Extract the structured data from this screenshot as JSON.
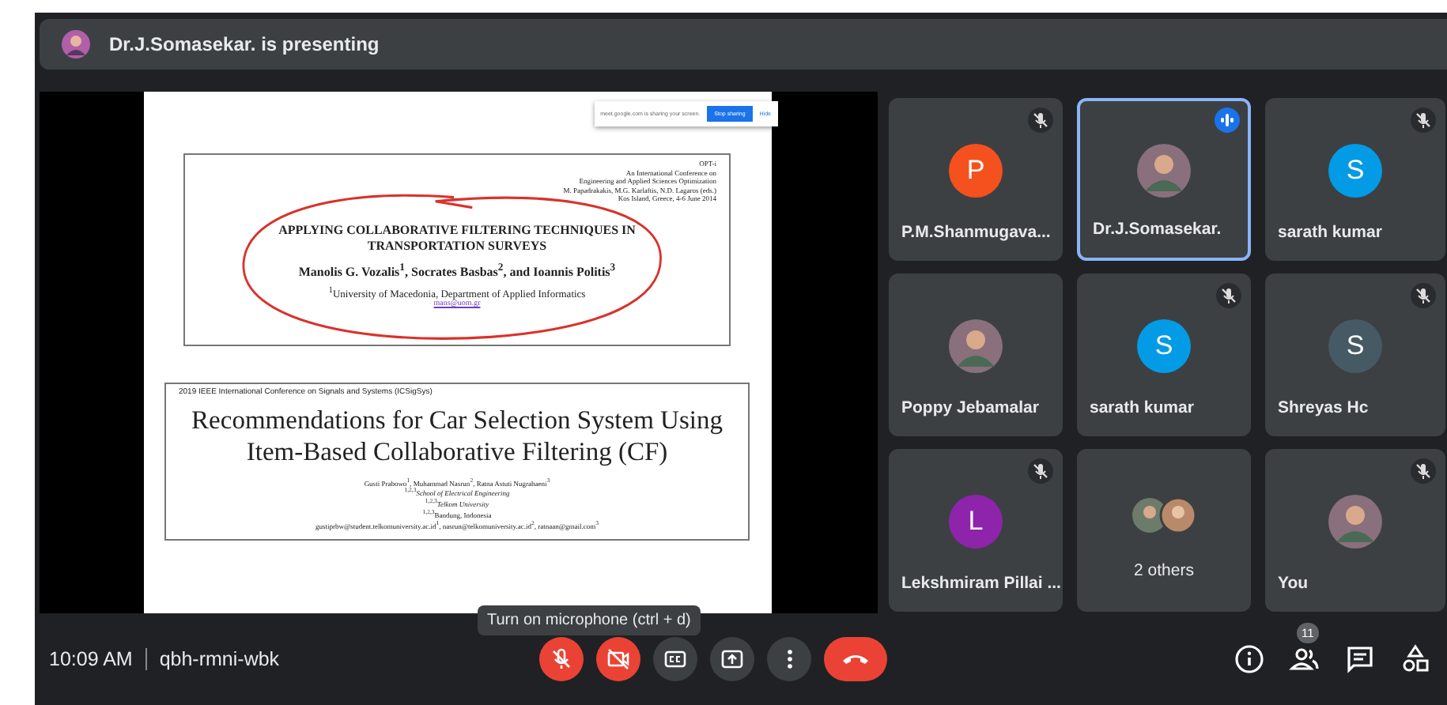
{
  "header": {
    "presenter_text": "Dr.J.Somasekar. is presenting"
  },
  "presentation": {
    "share_banner": {
      "message": "meet.google.com is sharing your screen.",
      "stop_button": "Stop sharing",
      "hide_link": "Hide"
    },
    "papers": [
      {
        "kind": "annotated",
        "header_lines": [
          "OPT-i",
          "An International Conference on",
          "Engineering and Applied Sciences Optimization",
          "M. Papadrakakis, M.G. Karlaftis, N.D. Lagaros (eds.)",
          "Kos Island, Greece, 4-6 June 2014"
        ],
        "title": "APPLYING COLLABORATIVE FILTERING TECHNIQUES IN TRANSPORTATION SURVEYS",
        "authors": "Manolis G. Vozalis$^{1}$, Socrates Basbas$^{2}$, and Ioannis Politis$^{3}$",
        "details": [
          "$^{1}$University of Macedonia, Department of Applied Informatics"
        ],
        "email": "mans@uom.gr"
      },
      {
        "kind": "plain",
        "header_lines": [
          "2019 IEEE International Conference on Signals and Systems (ICSigSys)"
        ],
        "title": "Recommendations for Car Selection System Using Item-Based Collaborative Filtering (CF)",
        "authors": "Gusti Prabowo$^{1}$, Muhammad Nasrun$^{2}$, Ratna Astuti Nugrahaeni$^{3}$",
        "details": [
          "$^{1,2,3}$*School of Electrical Engineering*",
          "$^{1,2,3}$*Telkom University*",
          "$^{1,2,3}$Bandung, Indonesia",
          "gustiprbw@student.telkomuniversity.ac.id$^{1}$, nasrun@telkomuniversity.ac.id$^{2}$, ratnaan@gmail.com$^{3}$"
        ]
      }
    ]
  },
  "tiles": [
    {
      "name": "P.M.Shanmugava...",
      "avatar": {
        "kind": "letter",
        "letter": "P",
        "color": "#f4511e"
      },
      "muted": true,
      "selected": false
    },
    {
      "name": "Dr.J.Somasekar.",
      "avatar": {
        "kind": "photo"
      },
      "muted": false,
      "selected": true
    },
    {
      "name": "sarath kumar",
      "avatar": {
        "kind": "letter",
        "letter": "S",
        "color": "#039be5"
      },
      "muted": true,
      "selected": false
    },
    {
      "name": "Poppy Jebamalar",
      "avatar": {
        "kind": "photo"
      },
      "muted": false,
      "selected": false
    },
    {
      "name": "sarath kumar",
      "avatar": {
        "kind": "letter",
        "letter": "S",
        "color": "#039be5"
      },
      "muted": true,
      "selected": false
    },
    {
      "name": "Shreyas Hc",
      "avatar": {
        "kind": "letter",
        "letter": "S",
        "color": "#455a64"
      },
      "muted": true,
      "selected": false
    },
    {
      "name": "Lekshmiram Pillai ...",
      "avatar": {
        "kind": "letter",
        "letter": "L",
        "color": "#8e24aa"
      },
      "muted": true,
      "selected": false
    },
    {
      "name": "2 others",
      "avatar": {
        "kind": "group"
      },
      "muted": false,
      "selected": false
    },
    {
      "name": "You",
      "avatar": {
        "kind": "photo"
      },
      "muted": true,
      "selected": false
    }
  ],
  "tooltip": "Turn on microphone (ctrl + d)",
  "bottom_bar": {
    "time": "10:09 AM",
    "meeting_code": "qbh-rmni-wbk",
    "microphone_on": false,
    "camera_on": false,
    "participant_count": "11"
  }
}
